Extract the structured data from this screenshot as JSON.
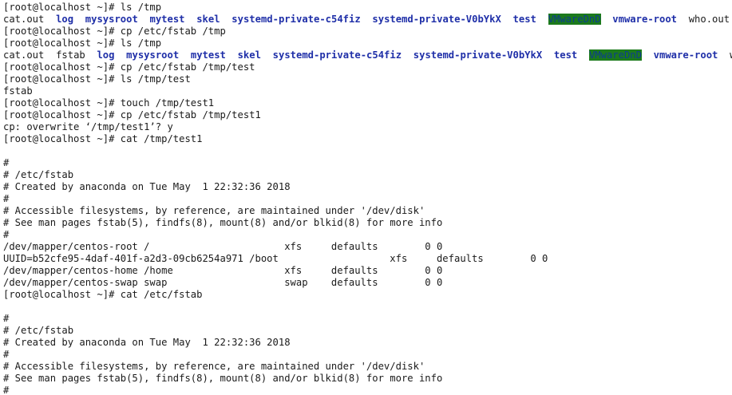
{
  "terminal": {
    "prompt": "[root@localhost ~]# ",
    "lines": [
      {
        "type": "cmd",
        "text": "ls /tmp"
      },
      {
        "type": "ls",
        "items": [
          {
            "t": "cat.out",
            "k": "file"
          },
          {
            "t": "log",
            "k": "dir"
          },
          {
            "t": "mysysroot",
            "k": "dir"
          },
          {
            "t": "mytest",
            "k": "dir"
          },
          {
            "t": "skel",
            "k": "dir"
          },
          {
            "t": "systemd-private-c54fiz",
            "k": "dir"
          },
          {
            "t": "systemd-private-V0bYkX",
            "k": "dir"
          },
          {
            "t": "test",
            "k": "dir"
          },
          {
            "t": "VMwareDnD",
            "k": "hl"
          },
          {
            "t": "vmware-root",
            "k": "dir"
          },
          {
            "t": "who.out",
            "k": "file"
          }
        ]
      },
      {
        "type": "cmd",
        "text": "cp /etc/fstab /tmp"
      },
      {
        "type": "cmd",
        "text": "ls /tmp"
      },
      {
        "type": "ls",
        "items": [
          {
            "t": "cat.out",
            "k": "file"
          },
          {
            "t": "fstab",
            "k": "file"
          },
          {
            "t": "log",
            "k": "dir"
          },
          {
            "t": "mysysroot",
            "k": "dir"
          },
          {
            "t": "mytest",
            "k": "dir"
          },
          {
            "t": "skel",
            "k": "dir"
          },
          {
            "t": "systemd-private-c54fiz",
            "k": "dir"
          },
          {
            "t": "systemd-private-V0bYkX",
            "k": "dir"
          },
          {
            "t": "test",
            "k": "dir"
          },
          {
            "t": "VMwareDnD",
            "k": "hl"
          },
          {
            "t": "vmware-root",
            "k": "dir"
          },
          {
            "t": "who.out",
            "k": "file"
          }
        ]
      },
      {
        "type": "cmd",
        "text": "cp /etc/fstab /tmp/test"
      },
      {
        "type": "cmd",
        "text": "ls /tmp/test"
      },
      {
        "type": "out",
        "text": "fstab"
      },
      {
        "type": "cmd",
        "text": "touch /tmp/test1"
      },
      {
        "type": "cmd",
        "text": "cp /etc/fstab /tmp/test1"
      },
      {
        "type": "out",
        "text": "cp: overwrite ‘/tmp/test1’? y"
      },
      {
        "type": "cmd",
        "text": "cat /tmp/test1"
      },
      {
        "type": "out",
        "text": ""
      },
      {
        "type": "out",
        "text": "#"
      },
      {
        "type": "out",
        "text": "# /etc/fstab"
      },
      {
        "type": "out",
        "text": "# Created by anaconda on Tue May  1 22:32:36 2018"
      },
      {
        "type": "out",
        "text": "#"
      },
      {
        "type": "out",
        "text": "# Accessible filesystems, by reference, are maintained under '/dev/disk'"
      },
      {
        "type": "out",
        "text": "# See man pages fstab(5), findfs(8), mount(8) and/or blkid(8) for more info"
      },
      {
        "type": "out",
        "text": "#"
      },
      {
        "type": "out",
        "text": "/dev/mapper/centos-root /                       xfs     defaults        0 0"
      },
      {
        "type": "out",
        "text": "UUID=b52cfe95-4daf-401f-a2d3-09cb6254a971 /boot                   xfs     defaults        0 0"
      },
      {
        "type": "out",
        "text": "/dev/mapper/centos-home /home                   xfs     defaults        0 0"
      },
      {
        "type": "out",
        "text": "/dev/mapper/centos-swap swap                    swap    defaults        0 0"
      },
      {
        "type": "cmd",
        "text": "cat /etc/fstab"
      },
      {
        "type": "out",
        "text": ""
      },
      {
        "type": "out",
        "text": "#"
      },
      {
        "type": "out",
        "text": "# /etc/fstab"
      },
      {
        "type": "out",
        "text": "# Created by anaconda on Tue May  1 22:32:36 2018"
      },
      {
        "type": "out",
        "text": "#"
      },
      {
        "type": "out",
        "text": "# Accessible filesystems, by reference, are maintained under '/dev/disk'"
      },
      {
        "type": "out",
        "text": "# See man pages fstab(5), findfs(8), mount(8) and/or blkid(8) for more info"
      },
      {
        "type": "out",
        "text": "#"
      }
    ]
  },
  "colors": {
    "background": "#ffffff",
    "text": "#1a1a1a",
    "directory": "#1f2fa8",
    "highlight_bg": "#1c7a1c",
    "highlight_fg": "#0c3d8f"
  }
}
